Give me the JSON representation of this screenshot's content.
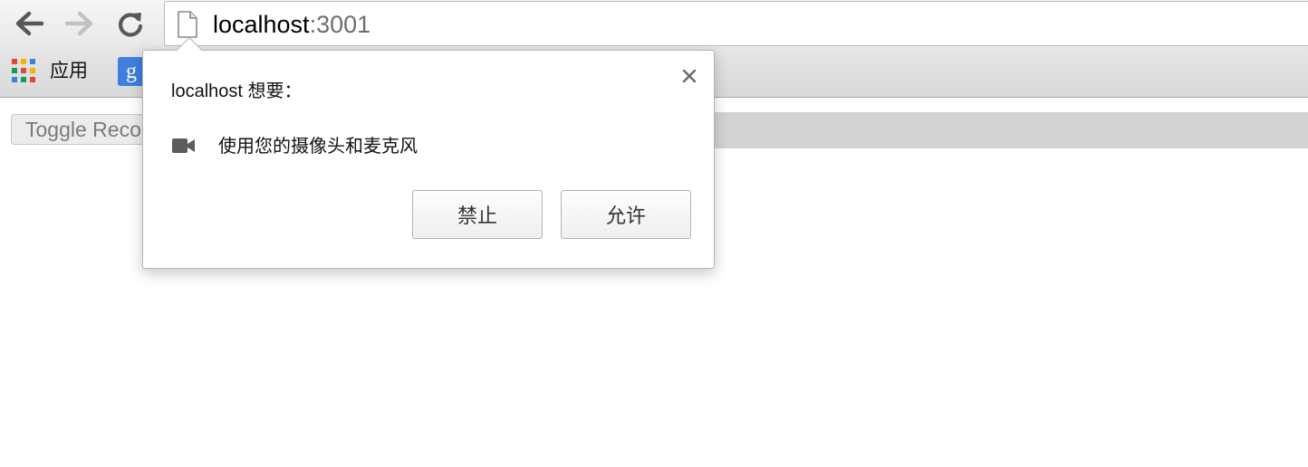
{
  "browser": {
    "url_host": "localhost",
    "url_port": ":3001",
    "icons": {
      "back": "back-arrow-icon",
      "forward": "forward-arrow-icon",
      "reload": "reload-icon",
      "page": "page-document-icon"
    }
  },
  "bookmarks": {
    "apps_label": "应用",
    "google_glyph": "g",
    "apps_colors": [
      "#e0463a",
      "#f4b400",
      "#3f7fe0",
      "#0f9d58",
      "#e0463a",
      "#f4b400",
      "#3f7fe0",
      "#0f9d58",
      "#e0463a"
    ]
  },
  "page": {
    "toggle_button_label": "Toggle Recording"
  },
  "permission_bubble": {
    "title": "localhost 想要：",
    "permission_text": "使用您的摄像头和麦克风",
    "permission_icon": "video-camera-icon",
    "close_icon": "close-icon",
    "block_label": "禁止",
    "allow_label": "允许"
  }
}
